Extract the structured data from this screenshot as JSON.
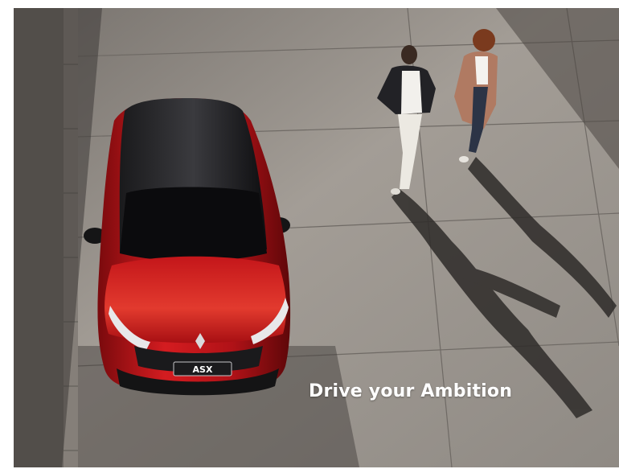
{
  "hero": {
    "tagline": "Drive your Ambition",
    "badge_text": "ASX",
    "car_color": "#c8141a",
    "roof_color": "#0d0d0f"
  }
}
